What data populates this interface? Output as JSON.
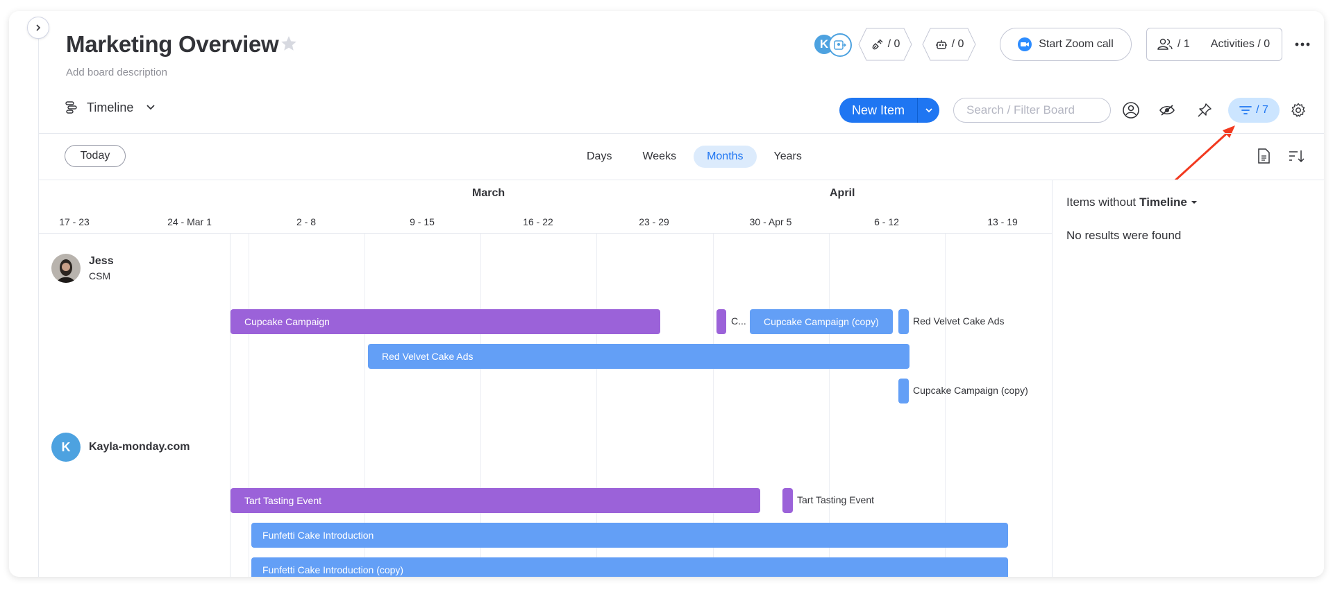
{
  "header": {
    "title": "Marketing Overview",
    "description": "Add board description",
    "avatar_initial": "K",
    "integrations_count": "/ 0",
    "automations_count": "/ 0",
    "zoom_label": "Start Zoom call",
    "members_count": "/ 1",
    "activities_label": "Activities / 0"
  },
  "toolbar": {
    "view_label": "Timeline",
    "new_item_label": "New Item",
    "search_placeholder": "Search / Filter Board",
    "filter_count": "/ 7"
  },
  "timeline_controls": {
    "today_label": "Today",
    "scales": [
      "Days",
      "Weeks",
      "Months",
      "Years"
    ],
    "active_scale": "Months"
  },
  "timeline": {
    "months": [
      "March",
      "April"
    ],
    "weeks": [
      "17 - 23",
      "24 - Mar 1",
      "2 - 8",
      "9 - 15",
      "16 - 22",
      "23 - 29",
      "30 - Apr 5",
      "6 - 12",
      "13 - 19"
    ],
    "groups": [
      {
        "name": "Jess",
        "role": "CSM",
        "items": [
          {
            "label": "Cupcake Campaign",
            "color": "purple"
          },
          {
            "label": "C...",
            "color": "purple"
          },
          {
            "label": "Cupcake Campaign (copy)",
            "color": "blue"
          },
          {
            "label": "Red Velvet Cake Ads",
            "color": "blue"
          },
          {
            "label": "Red Velvet Cake Ads",
            "color": "blue"
          },
          {
            "label": "Cupcake Campaign (copy)",
            "color": "blue"
          }
        ]
      },
      {
        "name": "Kayla-monday.com",
        "initial": "K",
        "items": [
          {
            "label": "Tart Tasting Event",
            "color": "purple"
          },
          {
            "label": "Tart Tasting Event",
            "color": "purple"
          },
          {
            "label": "Funfetti Cake Introduction",
            "color": "blue"
          },
          {
            "label": "Funfetti Cake Introduction (copy)",
            "color": "blue"
          }
        ]
      }
    ]
  },
  "side_panel": {
    "prefix": "Items without",
    "column": "Timeline",
    "empty_text": "No results were found"
  },
  "colors": {
    "primary": "#1f76f2",
    "purple_bar": "#9b62d9",
    "blue_bar": "#639ff6",
    "annotation": "#f2391f"
  }
}
